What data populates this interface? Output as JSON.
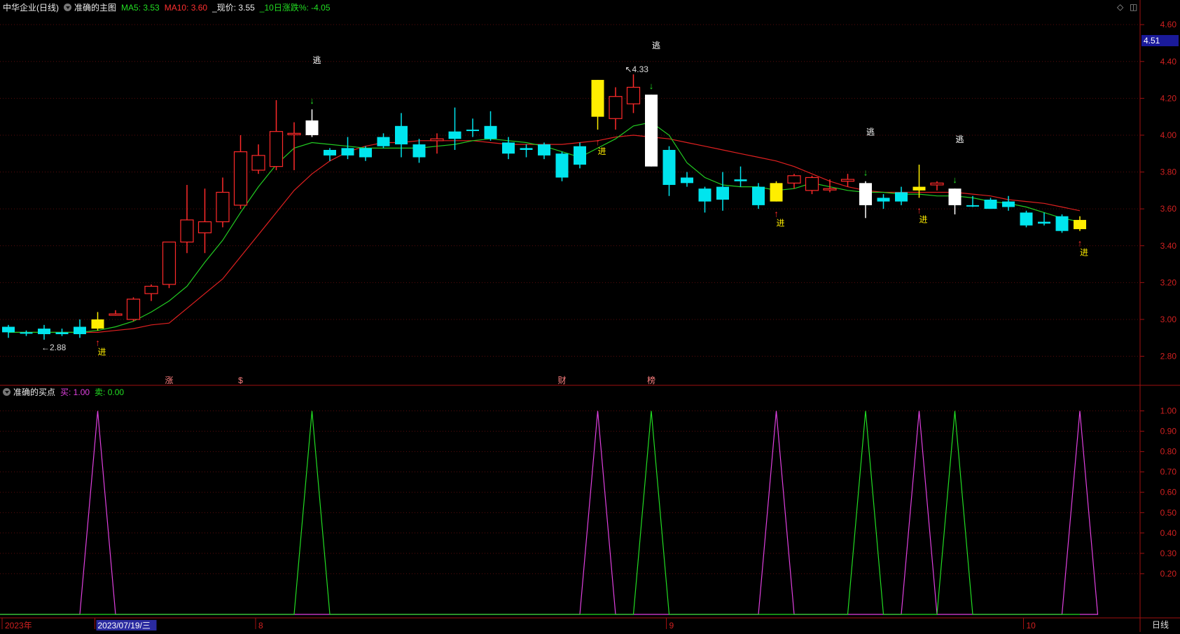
{
  "main_header": {
    "stock": "中华企业(日线)",
    "indicator": "准确的主图",
    "ma5": "MA5: 3.53",
    "ma10": "MA10: 3.60",
    "price": "_现价: 3.55",
    "change": "_10日涨跌%: -4.05"
  },
  "sub_header": {
    "indicator": "准确的买点",
    "buy": "买: 1.00",
    "sell": "卖: 0.00"
  },
  "price_badge": "4.51",
  "period_label": "日线",
  "price_axis": {
    "ylim": [
      2.65,
      4.65
    ],
    "ticks": [
      "4.60",
      "4.40",
      "4.20",
      "4.00",
      "3.80",
      "3.60",
      "3.40",
      "3.20",
      "3.00",
      "2.80"
    ]
  },
  "signal_axis": {
    "ylim": [
      0,
      1.05
    ],
    "ticks": [
      "1.00",
      "0.90",
      "0.80",
      "0.70",
      "0.60",
      "0.50",
      "0.40",
      "0.30",
      "0.20"
    ]
  },
  "time_axis": [
    {
      "label": "2023年",
      "i": 0
    },
    {
      "label": "2023/07/19/三",
      "i": 5,
      "highlight": true
    },
    {
      "label": "8",
      "i": 14
    },
    {
      "label": "9",
      "i": 37
    },
    {
      "label": "10",
      "i": 57
    }
  ],
  "events": [
    {
      "label": "涨",
      "i": 9
    },
    {
      "label": "$",
      "i": 13
    },
    {
      "label": "财",
      "i": 31
    },
    {
      "label": "榜",
      "i": 36
    }
  ],
  "marks": {
    "min": "2.88",
    "max": "4.33"
  },
  "enter_label": "进",
  "escape_label": "逃",
  "chart_data": {
    "type": "candlestick",
    "candles": [
      {
        "o": 2.93,
        "h": 2.97,
        "l": 2.9,
        "c": 2.96,
        "k": "cyan"
      },
      {
        "o": 2.93,
        "h": 2.94,
        "l": 2.91,
        "c": 2.93,
        "k": "cyan"
      },
      {
        "o": 2.95,
        "h": 2.97,
        "l": 2.89,
        "c": 2.92,
        "k": "cyan"
      },
      {
        "o": 2.93,
        "h": 2.95,
        "l": 2.91,
        "c": 2.92,
        "k": "cyan"
      },
      {
        "o": 2.96,
        "h": 3.0,
        "l": 2.9,
        "c": 2.92,
        "k": "cyan"
      },
      {
        "o": 2.95,
        "h": 3.04,
        "l": 2.94,
        "c": 3.0,
        "k": "yellow"
      },
      {
        "o": 3.03,
        "h": 3.05,
        "l": 3.02,
        "c": 3.03,
        "k": "red"
      },
      {
        "o": 3.0,
        "h": 3.12,
        "l": 2.99,
        "c": 3.11,
        "k": "red"
      },
      {
        "o": 3.14,
        "h": 3.19,
        "l": 3.1,
        "c": 3.18,
        "k": "red"
      },
      {
        "o": 3.19,
        "h": 3.42,
        "l": 3.17,
        "c": 3.42,
        "k": "red"
      },
      {
        "o": 3.42,
        "h": 3.73,
        "l": 3.36,
        "c": 3.54,
        "k": "red"
      },
      {
        "o": 3.47,
        "h": 3.71,
        "l": 3.36,
        "c": 3.53,
        "k": "red"
      },
      {
        "o": 3.53,
        "h": 3.77,
        "l": 3.5,
        "c": 3.69,
        "k": "red"
      },
      {
        "o": 3.62,
        "h": 4.0,
        "l": 3.6,
        "c": 3.91,
        "k": "red"
      },
      {
        "o": 3.89,
        "h": 3.95,
        "l": 3.79,
        "c": 3.81,
        "k": "red"
      },
      {
        "o": 3.83,
        "h": 4.19,
        "l": 3.81,
        "c": 4.02,
        "k": "red"
      },
      {
        "o": 4.01,
        "h": 4.07,
        "l": 3.81,
        "c": 4.01,
        "k": "red"
      },
      {
        "o": 4.08,
        "h": 4.14,
        "l": 3.99,
        "c": 4.0,
        "k": "white"
      },
      {
        "o": 3.92,
        "h": 3.93,
        "l": 3.86,
        "c": 3.89,
        "k": "cyan"
      },
      {
        "o": 3.93,
        "h": 3.99,
        "l": 3.87,
        "c": 3.89,
        "k": "cyan"
      },
      {
        "o": 3.93,
        "h": 3.94,
        "l": 3.86,
        "c": 3.88,
        "k": "cyan"
      },
      {
        "o": 3.99,
        "h": 4.01,
        "l": 3.93,
        "c": 3.94,
        "k": "cyan"
      },
      {
        "o": 4.05,
        "h": 4.12,
        "l": 3.88,
        "c": 3.95,
        "k": "cyan"
      },
      {
        "o": 3.95,
        "h": 3.98,
        "l": 3.85,
        "c": 3.88,
        "k": "cyan"
      },
      {
        "o": 3.97,
        "h": 4.01,
        "l": 3.9,
        "c": 3.98,
        "k": "red"
      },
      {
        "o": 4.02,
        "h": 4.15,
        "l": 3.92,
        "c": 3.98,
        "k": "cyan"
      },
      {
        "o": 4.03,
        "h": 4.09,
        "l": 3.99,
        "c": 4.03,
        "k": "cyan"
      },
      {
        "o": 4.05,
        "h": 4.13,
        "l": 3.97,
        "c": 3.98,
        "k": "cyan"
      },
      {
        "o": 3.96,
        "h": 3.99,
        "l": 3.87,
        "c": 3.9,
        "k": "cyan"
      },
      {
        "o": 3.93,
        "h": 3.95,
        "l": 3.88,
        "c": 3.92,
        "k": "cyan"
      },
      {
        "o": 3.95,
        "h": 3.96,
        "l": 3.87,
        "c": 3.89,
        "k": "cyan"
      },
      {
        "o": 3.9,
        "h": 3.91,
        "l": 3.75,
        "c": 3.77,
        "k": "cyan"
      },
      {
        "o": 3.94,
        "h": 3.96,
        "l": 3.82,
        "c": 3.84,
        "k": "cyan"
      },
      {
        "o": 4.1,
        "h": 4.3,
        "l": 4.03,
        "c": 4.3,
        "k": "yellow"
      },
      {
        "o": 4.09,
        "h": 4.26,
        "l": 4.03,
        "c": 4.21,
        "k": "red"
      },
      {
        "o": 4.17,
        "h": 4.33,
        "l": 4.12,
        "c": 4.26,
        "k": "red"
      },
      {
        "o": 4.22,
        "h": 4.22,
        "l": 3.83,
        "c": 3.83,
        "k": "white"
      },
      {
        "o": 3.92,
        "h": 3.94,
        "l": 3.67,
        "c": 3.73,
        "k": "cyan"
      },
      {
        "o": 3.77,
        "h": 3.8,
        "l": 3.72,
        "c": 3.74,
        "k": "cyan"
      },
      {
        "o": 3.71,
        "h": 3.72,
        "l": 3.58,
        "c": 3.64,
        "k": "cyan"
      },
      {
        "o": 3.72,
        "h": 3.8,
        "l": 3.59,
        "c": 3.65,
        "k": "cyan"
      },
      {
        "o": 3.76,
        "h": 3.83,
        "l": 3.72,
        "c": 3.75,
        "k": "cyan"
      },
      {
        "o": 3.72,
        "h": 3.74,
        "l": 3.6,
        "c": 3.62,
        "k": "cyan"
      },
      {
        "o": 3.64,
        "h": 3.75,
        "l": 3.64,
        "c": 3.74,
        "k": "yellow"
      },
      {
        "o": 3.74,
        "h": 3.79,
        "l": 3.71,
        "c": 3.78,
        "k": "red"
      },
      {
        "o": 3.7,
        "h": 3.78,
        "l": 3.68,
        "c": 3.77,
        "k": "red"
      },
      {
        "o": 3.71,
        "h": 3.76,
        "l": 3.69,
        "c": 3.71,
        "k": "red"
      },
      {
        "o": 3.76,
        "h": 3.79,
        "l": 3.72,
        "c": 3.75,
        "k": "red"
      },
      {
        "o": 3.74,
        "h": 3.75,
        "l": 3.55,
        "c": 3.62,
        "k": "white"
      },
      {
        "o": 3.66,
        "h": 3.68,
        "l": 3.6,
        "c": 3.64,
        "k": "cyan"
      },
      {
        "o": 3.69,
        "h": 3.72,
        "l": 3.62,
        "c": 3.64,
        "k": "cyan"
      },
      {
        "o": 3.7,
        "h": 3.84,
        "l": 3.66,
        "c": 3.72,
        "k": "yellow"
      },
      {
        "o": 3.73,
        "h": 3.75,
        "l": 3.7,
        "c": 3.74,
        "k": "red"
      },
      {
        "o": 3.71,
        "h": 3.71,
        "l": 3.57,
        "c": 3.62,
        "k": "white"
      },
      {
        "o": 3.62,
        "h": 3.67,
        "l": 3.61,
        "c": 3.62,
        "k": "cyan"
      },
      {
        "o": 3.65,
        "h": 3.66,
        "l": 3.6,
        "c": 3.6,
        "k": "cyan"
      },
      {
        "o": 3.64,
        "h": 3.67,
        "l": 3.59,
        "c": 3.61,
        "k": "cyan"
      },
      {
        "o": 3.58,
        "h": 3.59,
        "l": 3.5,
        "c": 3.51,
        "k": "cyan"
      },
      {
        "o": 3.53,
        "h": 3.58,
        "l": 3.51,
        "c": 3.52,
        "k": "cyan"
      },
      {
        "o": 3.56,
        "h": 3.57,
        "l": 3.47,
        "c": 3.48,
        "k": "cyan"
      },
      {
        "o": 3.54,
        "h": 3.56,
        "l": 3.48,
        "c": 3.49,
        "k": "yellow"
      }
    ],
    "ma5": [
      2.93,
      2.93,
      2.93,
      2.93,
      2.93,
      2.94,
      2.96,
      2.99,
      3.04,
      3.1,
      3.18,
      3.31,
      3.43,
      3.58,
      3.72,
      3.84,
      3.93,
      3.96,
      3.95,
      3.94,
      3.93,
      3.93,
      3.93,
      3.93,
      3.94,
      3.95,
      3.97,
      3.98,
      3.97,
      3.96,
      3.94,
      3.91,
      3.88,
      3.93,
      3.98,
      4.05,
      4.07,
      4.0,
      3.85,
      3.77,
      3.73,
      3.72,
      3.72,
      3.7,
      3.71,
      3.74,
      3.72,
      3.7,
      3.69,
      3.69,
      3.68,
      3.68,
      3.67,
      3.67,
      3.66,
      3.64,
      3.63,
      3.61,
      3.58,
      3.55,
      3.53
    ],
    "ma10": [
      2.93,
      2.93,
      2.93,
      2.93,
      2.93,
      2.93,
      2.94,
      2.95,
      2.97,
      2.98,
      3.06,
      3.14,
      3.22,
      3.34,
      3.46,
      3.58,
      3.7,
      3.79,
      3.86,
      3.91,
      3.94,
      3.96,
      3.96,
      3.97,
      3.97,
      3.97,
      3.97,
      3.96,
      3.95,
      3.95,
      3.95,
      3.95,
      3.96,
      3.97,
      3.99,
      4.0,
      3.99,
      3.98,
      3.96,
      3.94,
      3.92,
      3.9,
      3.88,
      3.86,
      3.83,
      3.79,
      3.75,
      3.72,
      3.7,
      3.69,
      3.69,
      3.69,
      3.69,
      3.69,
      3.68,
      3.67,
      3.65,
      3.64,
      3.63,
      3.61,
      3.59
    ],
    "enter_i": [
      5,
      33,
      43,
      51,
      60
    ],
    "escape_i": [
      17,
      36,
      48,
      53
    ],
    "signal": {
      "buy": {
        "name": "买",
        "peaks_i": [
          5,
          33,
          43,
          51,
          60
        ],
        "color": "#e040e0"
      },
      "sell": {
        "name": "卖",
        "peaks_i": [
          17,
          36,
          48,
          53
        ],
        "color": "#22dd22"
      }
    }
  }
}
